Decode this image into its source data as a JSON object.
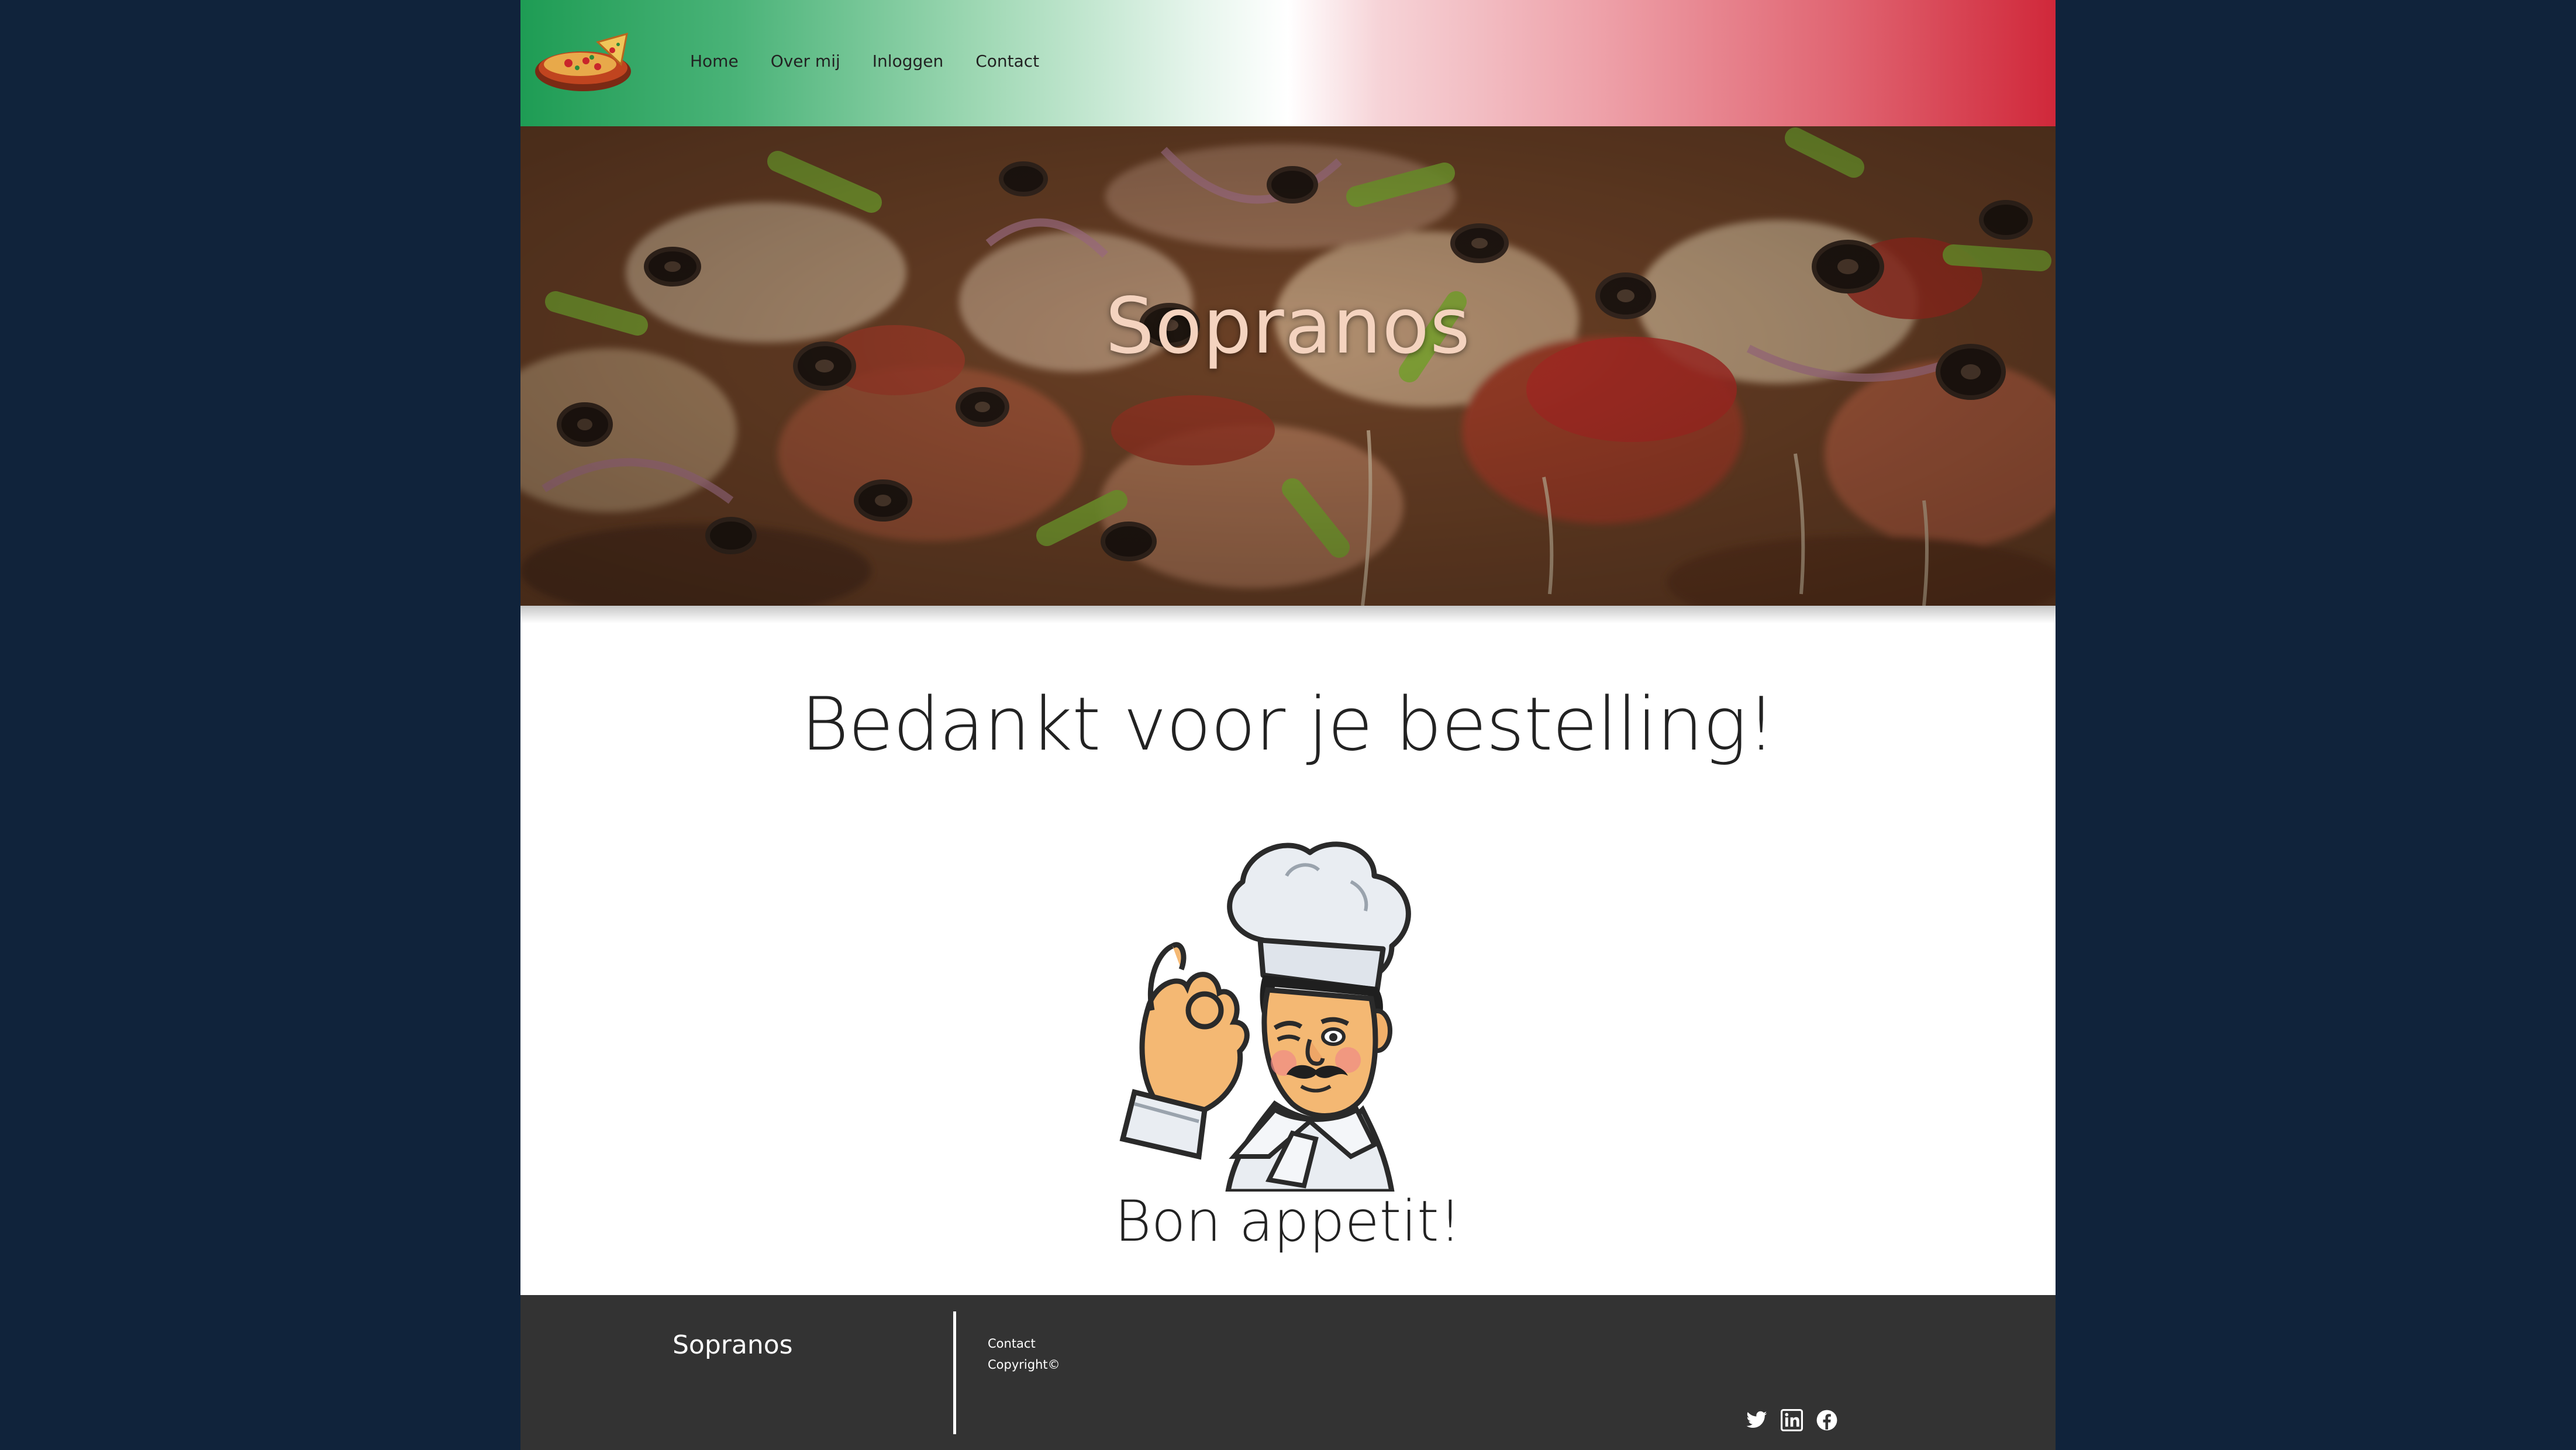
{
  "header": {
    "logo_icon": "pizza-logo-icon",
    "nav": [
      {
        "label": "Home"
      },
      {
        "label": "Over mij"
      },
      {
        "label": "Inloggen"
      },
      {
        "label": "Contact"
      }
    ],
    "gradient_colors": [
      "#1e9c54",
      "#ffffff",
      "#d0283a"
    ]
  },
  "hero": {
    "title": "Sopranos",
    "background": "pizza-photo"
  },
  "main": {
    "heading": "Bedankt voor je bestelling!",
    "illustration": "chef-ok-sign",
    "subheading": "Bon appetit!"
  },
  "footer": {
    "brand": "Sopranos",
    "links": [
      {
        "label": "Contact"
      },
      {
        "label": "Copyright©"
      }
    ],
    "social": [
      "twitter-icon",
      "linkedin-icon",
      "facebook-icon"
    ],
    "background_color": "#333333"
  },
  "colors": {
    "page_background": "#10233b",
    "accent_green": "#1e9c54",
    "accent_red": "#d0283a"
  }
}
